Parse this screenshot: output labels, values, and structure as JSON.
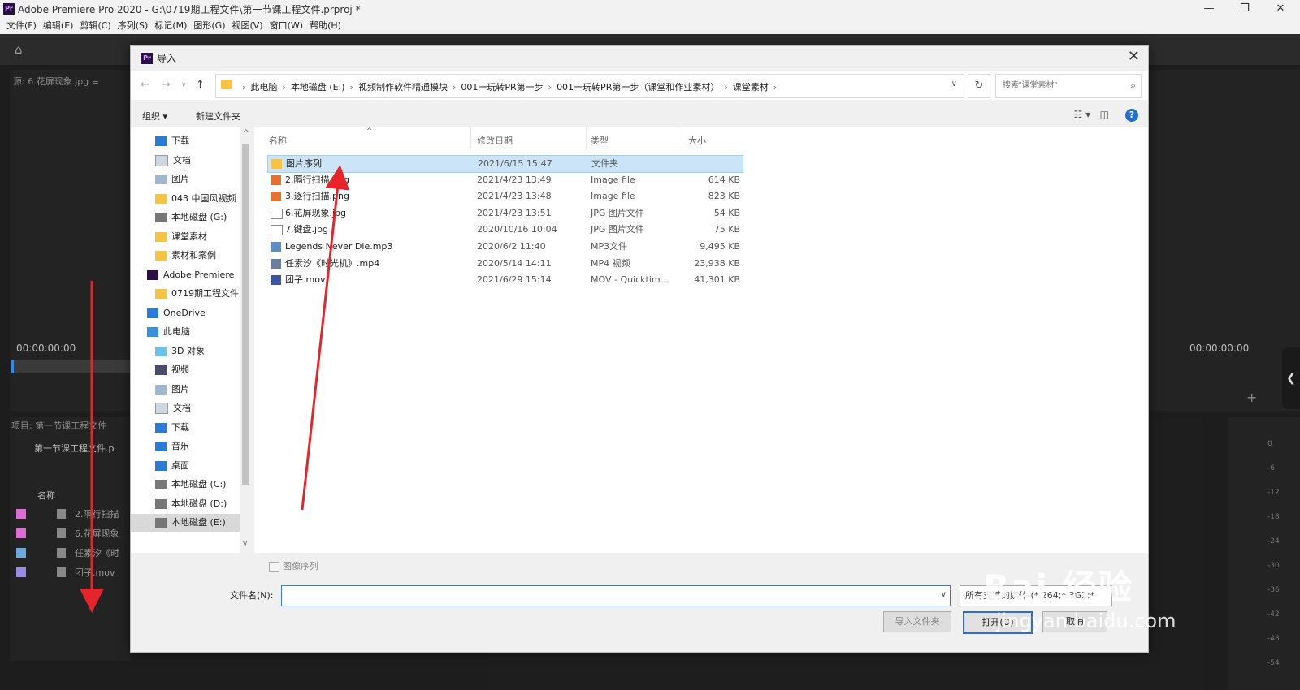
{
  "app": {
    "title": "Adobe Premiere Pro 2020 - G:\\0719期工程文件\\第一节课工程文件.prproj *",
    "menu": [
      "文件(F)",
      "编辑(E)",
      "剪辑(C)",
      "序列(S)",
      "标记(M)",
      "图形(G)",
      "视图(V)",
      "窗口(W)",
      "帮助(H)"
    ],
    "source_tab": "源: 6.花屏现象.jpg ≡",
    "timecode_left": "00:00:00:00",
    "timecode_right": "00:00:00:00",
    "project_tab": "项目: 第一节课工程文件",
    "project_file": "第一节课工程文件.p",
    "project_col_name": "名称",
    "project_items": [
      {
        "label": "2.隔行扫描",
        "color": "#e06ad6"
      },
      {
        "label": "6.花屏现象",
        "color": "#e06ad6"
      },
      {
        "label": "任素汐《时",
        "color": "#6aa8e0"
      },
      {
        "label": "团子.mov",
        "color": "#9b8ae6"
      }
    ],
    "meter_labels": [
      "0",
      "-6",
      "-12",
      "-18",
      "-24",
      "-30",
      "-36",
      "-42",
      "-48",
      "-54"
    ]
  },
  "dialog": {
    "title": "导入",
    "breadcrumb": [
      "此电脑",
      "本地磁盘 (E:)",
      "视频制作软件精通模块",
      "001一玩转PR第一步",
      "001一玩转PR第一步（课堂和作业素材）",
      "课堂素材"
    ],
    "search_placeholder": "搜索\"课堂素材\"",
    "organize": "组织 ▾",
    "new_folder": "新建文件夹",
    "tree": [
      {
        "label": "下载",
        "icon": "download-icon",
        "pin": true,
        "indent": 1
      },
      {
        "label": "文档",
        "icon": "document-icon",
        "pin": true,
        "indent": 1
      },
      {
        "label": "图片",
        "icon": "pictures-icon",
        "pin": true,
        "indent": 1
      },
      {
        "label": "043 中国风视频",
        "icon": "folder-icon",
        "pin": false,
        "indent": 1
      },
      {
        "label": "本地磁盘 (G:)",
        "icon": "drive-icon",
        "pin": false,
        "indent": 1
      },
      {
        "label": "课堂素材",
        "icon": "folder-icon",
        "pin": false,
        "indent": 1
      },
      {
        "label": "素材和案例",
        "icon": "folder-icon",
        "pin": false,
        "indent": 1
      },
      {
        "label": "Adobe Premiere",
        "icon": "premiere-icon",
        "pin": false,
        "indent": 0
      },
      {
        "label": "0719期工程文件",
        "icon": "folder-icon",
        "pin": false,
        "indent": 1
      },
      {
        "label": "OneDrive",
        "icon": "cloud-icon",
        "pin": false,
        "indent": 0
      },
      {
        "label": "此电脑",
        "icon": "computer-icon",
        "pin": false,
        "indent": 0
      },
      {
        "label": "3D 对象",
        "icon": "3d-objects-icon",
        "pin": false,
        "indent": 1
      },
      {
        "label": "视频",
        "icon": "video-icon",
        "pin": false,
        "indent": 1
      },
      {
        "label": "图片",
        "icon": "pictures-icon",
        "pin": false,
        "indent": 1
      },
      {
        "label": "文档",
        "icon": "document-icon",
        "pin": false,
        "indent": 1
      },
      {
        "label": "下载",
        "icon": "download-icon",
        "pin": false,
        "indent": 1
      },
      {
        "label": "音乐",
        "icon": "music-icon",
        "pin": false,
        "indent": 1
      },
      {
        "label": "桌面",
        "icon": "desktop-icon",
        "pin": false,
        "indent": 1
      },
      {
        "label": "本地磁盘 (C:)",
        "icon": "drive-icon",
        "pin": false,
        "indent": 1
      },
      {
        "label": "本地磁盘 (D:)",
        "icon": "drive-icon",
        "pin": false,
        "indent": 1
      },
      {
        "label": "本地磁盘 (E:)",
        "icon": "drive-icon",
        "pin": false,
        "indent": 1,
        "selected": true
      }
    ],
    "columns": {
      "name": "名称",
      "date": "修改日期",
      "type": "类型",
      "size": "大小"
    },
    "files": [
      {
        "name": "图片序列",
        "date": "2021/6/15 15:47",
        "type": "文件夹",
        "size": "",
        "icon": "folder-icon",
        "selected": true
      },
      {
        "name": "2.隔行扫描.png",
        "date": "2021/4/23 13:49",
        "type": "Image file",
        "size": "614 KB",
        "icon": "image-file-icon"
      },
      {
        "name": "3.逐行扫描.png",
        "date": "2021/4/23 13:48",
        "type": "Image file",
        "size": "823 KB",
        "icon": "image-file-icon"
      },
      {
        "name": "6.花屏现象.jpg",
        "date": "2021/4/23 13:51",
        "type": "JPG 图片文件",
        "size": "54 KB",
        "icon": "file-icon"
      },
      {
        "name": "7.键盘.jpg",
        "date": "2020/10/16 10:04",
        "type": "JPG 图片文件",
        "size": "75 KB",
        "icon": "file-icon"
      },
      {
        "name": "Legends Never Die.mp3",
        "date": "2020/6/2 11:40",
        "type": "MP3文件",
        "size": "9,495 KB",
        "icon": "audio-file-icon"
      },
      {
        "name": "任素汐《时光机》.mp4",
        "date": "2020/5/14 14:11",
        "type": "MP4 视频",
        "size": "23,938 KB",
        "icon": "video-file-icon"
      },
      {
        "name": "团子.mov",
        "date": "2021/6/29 15:14",
        "type": "MOV - Quicktim...",
        "size": "41,301 KB",
        "icon": "mov-file-icon"
      }
    ],
    "image_sequence_label": "图像序列",
    "filename_label": "文件名(N):",
    "filename_value": "",
    "filetype_value": "所有支持的媒体 (*.264;*.3G2;*",
    "import_folder": "导入文件夹",
    "open": "打开(O)",
    "cancel": "取消"
  },
  "watermark": {
    "text": "Bai 经验",
    "url": "jingyan.baidu.com"
  },
  "colors": {
    "arrow": "#e8242b",
    "selection": "#cce4f7",
    "accent": "#2b6fd4"
  }
}
